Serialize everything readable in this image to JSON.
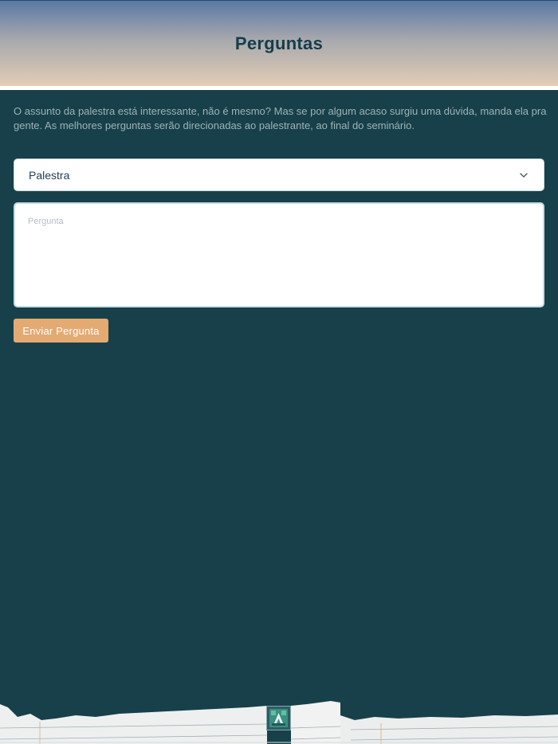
{
  "header": {
    "title": "Perguntas"
  },
  "intro": {
    "text": "O assunto da palestra está interessante, não é mesmo? Mas se por algum acaso surgiu uma dúvida, manda ela pra gente. As melhores perguntas serão direcionadas ao palestrante, ao final do seminário."
  },
  "form": {
    "select_value": "Palestra",
    "question_placeholder": "Pergunta",
    "submit_label": "Enviar Pergunta"
  },
  "colors": {
    "background": "#17404a",
    "accent_button": "#e3aa72",
    "title": "#163d4a"
  },
  "icons": {
    "select_arrow": "chevron-down-icon",
    "logo": "app-logo-icon"
  }
}
